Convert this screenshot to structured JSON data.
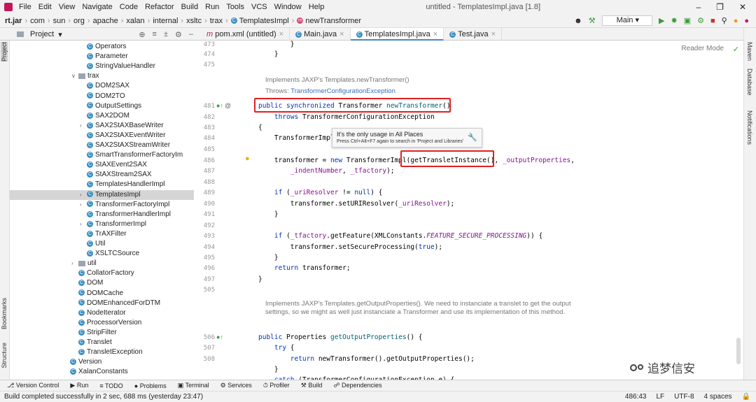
{
  "menu": [
    "File",
    "Edit",
    "View",
    "Navigate",
    "Code",
    "Refactor",
    "Build",
    "Run",
    "Tools",
    "VCS",
    "Window",
    "Help"
  ],
  "window_title": "untitled - TemplatesImpl.java [1.8]",
  "breadcrumb": [
    "rt.jar",
    "com",
    "sun",
    "org",
    "apache",
    "xalan",
    "internal",
    "xsltc",
    "trax",
    "TemplatesImpl",
    "newTransformer"
  ],
  "run_config": "Main",
  "project_header": "Project",
  "tabs": [
    "pom.xml (untitled)",
    "Main.java",
    "TemplatesImpl.java",
    "Test.java"
  ],
  "reader_mode": "Reader Mode",
  "tree": [
    {
      "label": "Operators",
      "kind": "class",
      "indent": 4
    },
    {
      "label": "Parameter",
      "kind": "class",
      "indent": 4
    },
    {
      "label": "StringValueHandler",
      "kind": "class",
      "indent": 4
    },
    {
      "label": "trax",
      "kind": "folder",
      "indent": 3,
      "arrow": "open"
    },
    {
      "label": "DOM2SAX",
      "kind": "class",
      "indent": 4
    },
    {
      "label": "DOM2TO",
      "kind": "class",
      "indent": 4
    },
    {
      "label": "OutputSettings",
      "kind": "class",
      "indent": 4
    },
    {
      "label": "SAX2DOM",
      "kind": "class",
      "indent": 4
    },
    {
      "label": "SAX2StAXBaseWriter",
      "kind": "class",
      "indent": 4,
      "arrow": "closed"
    },
    {
      "label": "SAX2StAXEventWriter",
      "kind": "class",
      "indent": 4
    },
    {
      "label": "SAX2StAXStreamWriter",
      "kind": "class",
      "indent": 4
    },
    {
      "label": "SmartTransformerFactoryIm",
      "kind": "class",
      "indent": 4
    },
    {
      "label": "StAXEvent2SAX",
      "kind": "class",
      "indent": 4
    },
    {
      "label": "StAXStream2SAX",
      "kind": "class",
      "indent": 4
    },
    {
      "label": "TemplatesHandlerImpl",
      "kind": "class",
      "indent": 4
    },
    {
      "label": "TemplatesImpl",
      "kind": "class",
      "indent": 4,
      "arrow": "closed",
      "selected": true
    },
    {
      "label": "TransformerFactoryImpl",
      "kind": "class",
      "indent": 4,
      "arrow": "closed"
    },
    {
      "label": "TransformerHandlerImpl",
      "kind": "class",
      "indent": 4
    },
    {
      "label": "TransformerImpl",
      "kind": "class",
      "indent": 4,
      "arrow": "closed"
    },
    {
      "label": "TrAXFilter",
      "kind": "class",
      "indent": 4
    },
    {
      "label": "Util",
      "kind": "class",
      "indent": 4
    },
    {
      "label": "XSLTCSource",
      "kind": "class",
      "indent": 4
    },
    {
      "label": "util",
      "kind": "folder",
      "indent": 3,
      "arrow": "closed"
    },
    {
      "label": "CollatorFactory",
      "kind": "class",
      "indent": 3
    },
    {
      "label": "DOM",
      "kind": "class",
      "indent": 3
    },
    {
      "label": "DOMCache",
      "kind": "class",
      "indent": 3
    },
    {
      "label": "DOMEnhancedForDTM",
      "kind": "class",
      "indent": 3
    },
    {
      "label": "NodeIterator",
      "kind": "class",
      "indent": 3
    },
    {
      "label": "ProcessorVersion",
      "kind": "class",
      "indent": 3
    },
    {
      "label": "StripFilter",
      "kind": "class",
      "indent": 3
    },
    {
      "label": "Translet",
      "kind": "class",
      "indent": 3
    },
    {
      "label": "TransletException",
      "kind": "class",
      "indent": 3
    },
    {
      "label": "Version",
      "kind": "class",
      "indent": 2
    },
    {
      "label": "XalanConstants",
      "kind": "class",
      "indent": 2
    }
  ],
  "line_numbers": [
    "473",
    "474",
    "475",
    "481",
    "482",
    "483",
    "484",
    "485",
    "486",
    "487",
    "488",
    "489",
    "490",
    "491",
    "492",
    "493",
    "494",
    "495",
    "496",
    "497",
    "505",
    "506",
    "507",
    "508"
  ],
  "doc1": {
    "line1": "Implements JAXP's Templates.newTransformer()",
    "throws_label": "Throws:",
    "throws_link": "TransformerConfigurationException"
  },
  "doc2": "Implements JAXP's Templates.getOutputProperties(). We need to instanciate a translet to get the output settings, so we might as well just instanciate a Transformer and use its implementation of this method.",
  "tooltip": {
    "title": "It's the only usage in All Places",
    "hint": "Press Ctrl+Alt+F7 again to search in 'Project and Libraries'"
  },
  "bottom_tools": [
    "Version Control",
    "Run",
    "TODO",
    "Problems",
    "Terminal",
    "Services",
    "Profiler",
    "Build",
    "Dependencies"
  ],
  "status": {
    "message": "Build completed successfully in 2 sec, 688 ms (yesterday 23:47)",
    "position": "486:43",
    "line_sep": "LF",
    "encoding": "UTF-8",
    "indent": "4 spaces"
  },
  "side_labels_left": [
    "Project",
    "Bookmarks",
    "Structure"
  ],
  "side_labels_right": [
    "Maven",
    "Database",
    "Notifications"
  ],
  "watermark": "追梦信安"
}
